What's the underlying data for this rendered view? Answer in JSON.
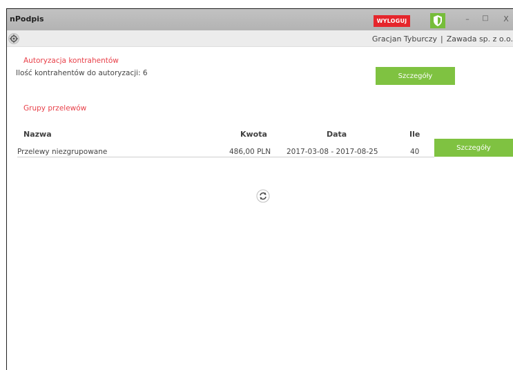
{
  "window": {
    "title": "nPodpis",
    "logout_label": "WYLOGUJ",
    "minimize_glyph": "–",
    "maximize_glyph": "□",
    "close_glyph": "X"
  },
  "userbar": {
    "user_name": "Gracjan Tyburczy",
    "separator": "|",
    "company": "Zawada sp. z o.o."
  },
  "authorization": {
    "title": "Autoryzacja kontrahentów",
    "count_text": "Ilość kontrahentów do autoryzacji: 6",
    "details_label": "Szczegóły"
  },
  "groups": {
    "title": "Grupy przelewów",
    "columns": {
      "name": "Nazwa",
      "amount": "Kwota",
      "date": "Data",
      "count": "Ile"
    },
    "rows": [
      {
        "name": "Przelewy niezgrupowane",
        "amount": "486,00 PLN",
        "date": "2017-03-08 - 2017-08-25",
        "count": "40",
        "details_label": "Szczegóły"
      }
    ]
  },
  "icons": {
    "settings": "gear-icon",
    "security": "shield-icon",
    "refresh": "refresh-icon"
  },
  "colors": {
    "accent_red": "#e84049",
    "logout_red": "#e5262c",
    "button_green": "#7fc241",
    "titlebar_gray": "#b8b8b8"
  }
}
